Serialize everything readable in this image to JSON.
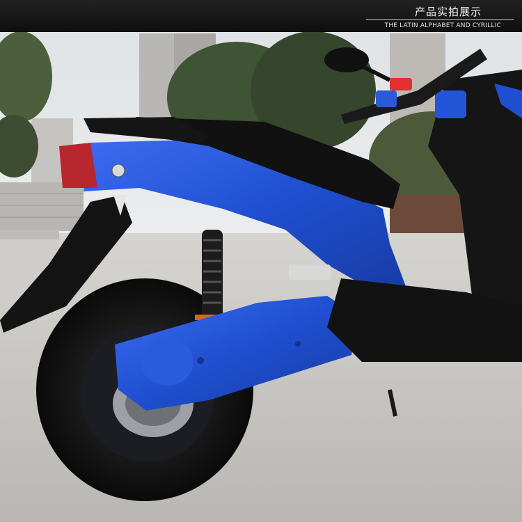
{
  "header": {
    "title": "产品实拍展示",
    "subtitle": "THE LATIN ALPHABET AND CYRILLIC"
  },
  "photo": {
    "subject": "blue-electric-scooter-rear",
    "colors": {
      "body_blue": "#1f4fd0",
      "body_blue_light": "#3a6af0",
      "tire": "#151515",
      "seat": "#101010",
      "ground": "#c8c6c2",
      "sky": "#e4e6e8",
      "trees": "#3d4f33"
    }
  }
}
